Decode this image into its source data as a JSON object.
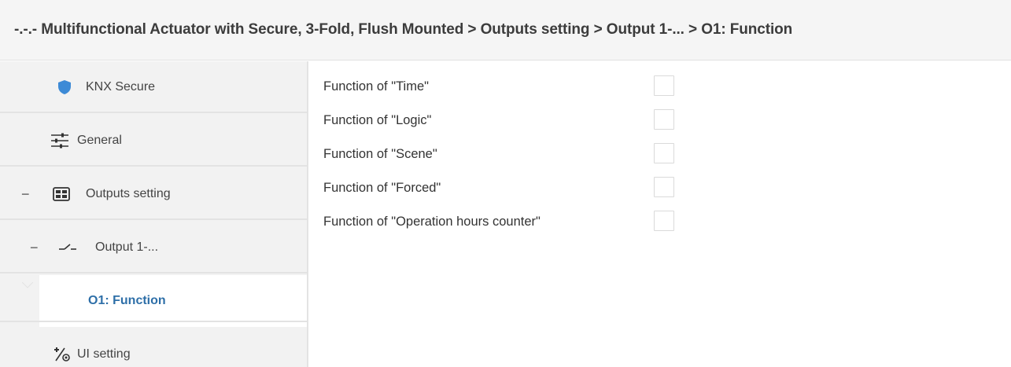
{
  "breadcrumb": {
    "text": "-.-.- Multifunctional Actuator with Secure, 3-Fold, Flush Mounted > Outputs setting > Output 1-... > O1: Function"
  },
  "sidebar": {
    "items": [
      {
        "label": "KNX Secure",
        "icon": "shield-icon"
      },
      {
        "label": "General",
        "icon": "sliders-icon"
      },
      {
        "label": "Outputs setting",
        "icon": "grid-icon",
        "collapse": "−"
      },
      {
        "label": "Output 1-...",
        "icon": "switch-icon",
        "collapse": "−"
      },
      {
        "label": "O1: Function",
        "selected": true
      },
      {
        "label": "UI setting",
        "icon": "ui-setting-icon"
      }
    ]
  },
  "params": [
    {
      "label": "Function of \"Time\"",
      "checked": false
    },
    {
      "label": "Function of \"Logic\"",
      "checked": false
    },
    {
      "label": "Function of \"Scene\"",
      "checked": false
    },
    {
      "label": "Function of \"Forced\"",
      "checked": false
    },
    {
      "label": "Function of \"Operation hours counter\"",
      "checked": false
    }
  ],
  "colors": {
    "accent": "#2e6fa8",
    "shield": "#3d8ad6",
    "sidebar_bg": "#f2f2f2",
    "header_bg": "#f5f5f5"
  }
}
